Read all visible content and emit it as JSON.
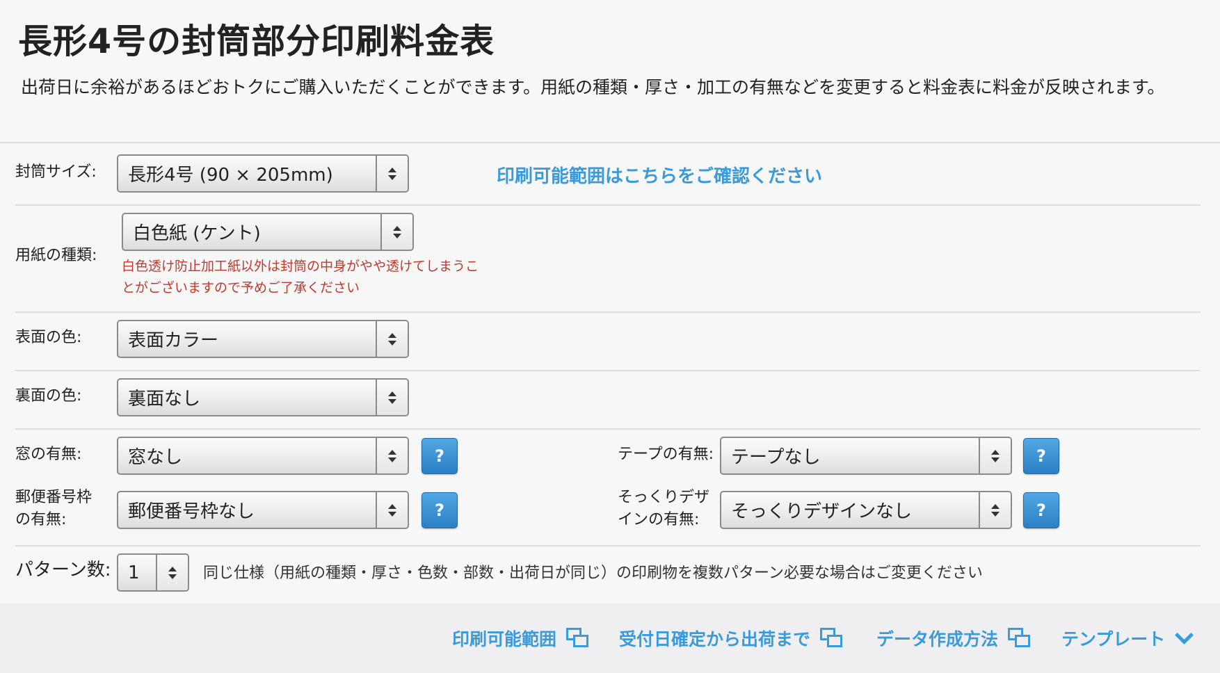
{
  "header": {
    "title": "長形4号の封筒部分印刷料金表",
    "description": "出荷日に余裕があるほどおトクにご購入いただくことができます。用紙の種類・厚さ・加工の有無などを変更すると料金表に料金が反映されます。"
  },
  "form": {
    "envelope_size": {
      "label": "封筒サイズ:",
      "value": "長形4号 (90 × 205mm)"
    },
    "print_range_link": "印刷可能範囲はこちらをご確認ください",
    "paper_type": {
      "label": "用紙の種類:",
      "value": "白色紙 (ケント)",
      "warning": "白色透け防止加工紙以外は封筒の中身がやや透けてしまうことがございますので予めご了承ください"
    },
    "front_color": {
      "label": "表面の色:",
      "value": "表面カラー"
    },
    "back_color": {
      "label": "裏面の色:",
      "value": "裏面なし"
    },
    "window": {
      "label": "窓の有無:",
      "value": "窓なし",
      "help": "?"
    },
    "tape": {
      "label": "テープの有無:",
      "value": "テープなし",
      "help": "?"
    },
    "postal_code": {
      "label_line1": "郵便番号枠",
      "label_line2": "の有無:",
      "value": "郵便番号枠なし",
      "help": "?"
    },
    "lookalike_design": {
      "label_line1": "そっくりデザ",
      "label_line2": "インの有無:",
      "value": "そっくりデザインなし",
      "help": "?"
    },
    "pattern_count": {
      "label": "パターン数:",
      "value": "1",
      "note": "同じ仕様（用紙の種類・厚さ・色数・部数・出荷日が同じ）の印刷物を複数パターン必要な場合はご変更ください"
    }
  },
  "footer": {
    "links": [
      "印刷可能範囲",
      "受付日確定から出荷まで",
      "データ作成方法",
      "テンプレート"
    ],
    "icons": [
      "external-window-icon",
      "external-window-icon",
      "external-window-icon",
      "chevron-down-icon"
    ]
  },
  "colors": {
    "link": "#3a9bdc",
    "warning": "#c0392b",
    "help_button": "#2b80c6"
  }
}
